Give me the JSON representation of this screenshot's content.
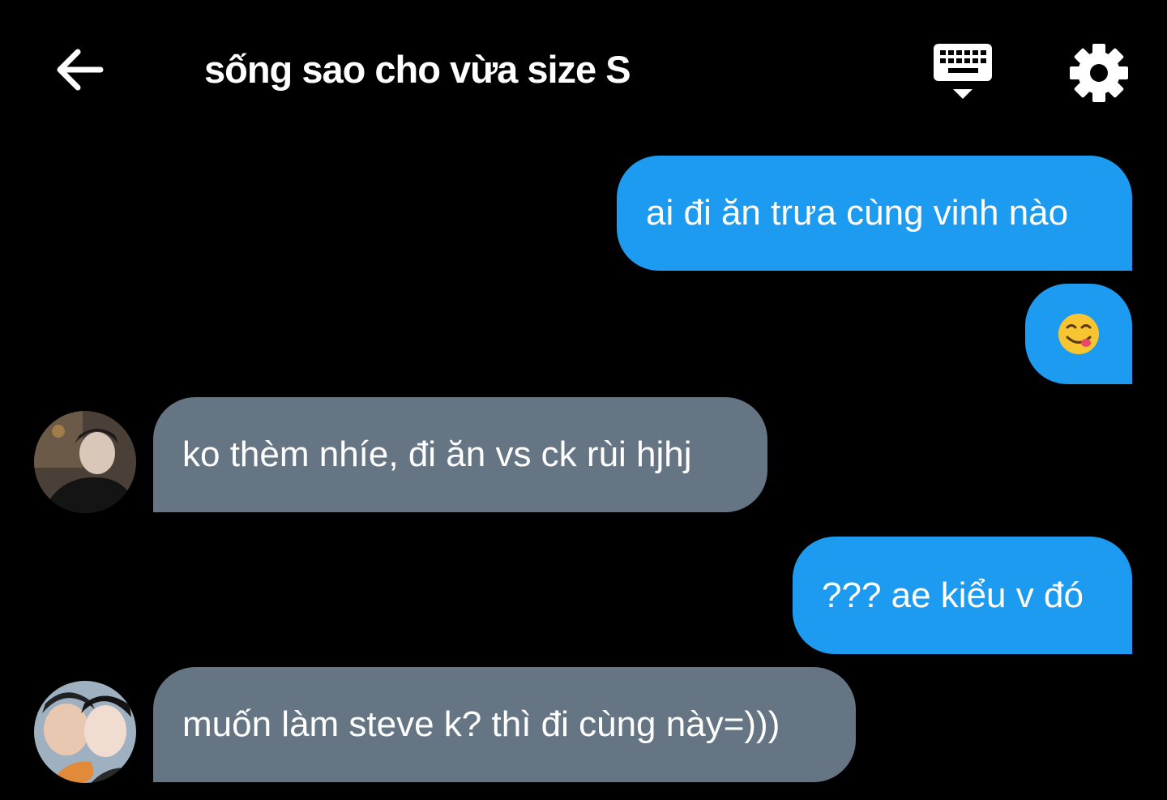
{
  "header": {
    "title": "sống sao cho vừa size S",
    "back_icon": "arrow-left-icon",
    "keyboard_icon": "keyboard-hide-icon",
    "settings_icon": "gear-icon"
  },
  "messages": [
    {
      "direction": "outgoing",
      "text": "ai đi ăn trưa cùng vinh nào"
    },
    {
      "direction": "outgoing",
      "text": "😋"
    },
    {
      "direction": "incoming",
      "text": "ko thèm nhíe, đi ăn vs ck rùi hjhj"
    },
    {
      "direction": "outgoing",
      "text": "??? ae kiểu v đó"
    },
    {
      "direction": "incoming",
      "text": "muốn làm steve k? thì đi cùng này=)))"
    }
  ],
  "colors": {
    "background": "#000000",
    "outgoing_bubble": "#1d9bf0",
    "incoming_bubble": "#667584",
    "text": "#ffffff"
  }
}
